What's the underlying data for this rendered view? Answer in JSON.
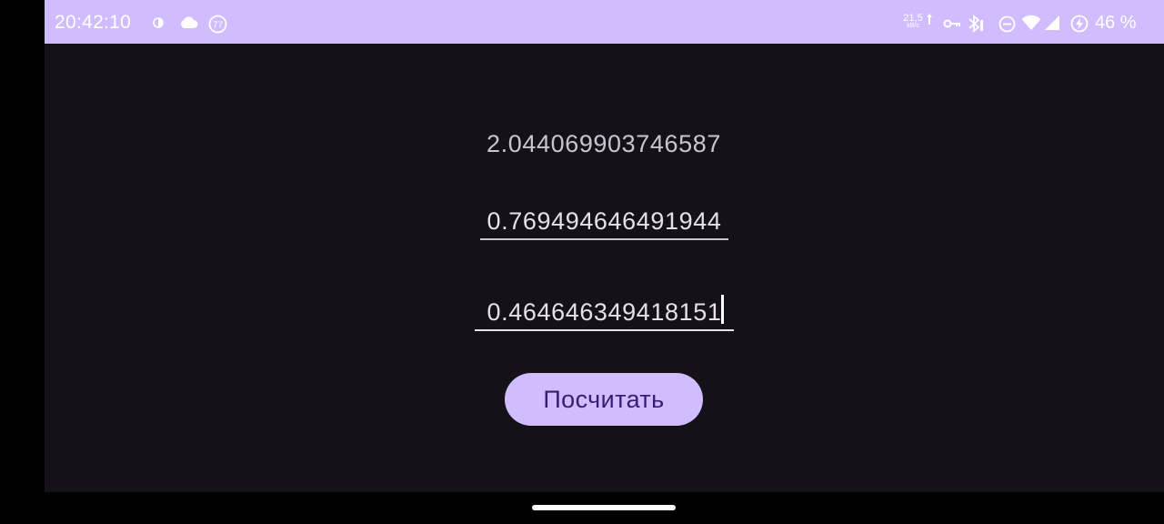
{
  "status_bar": {
    "time": "20:42:10",
    "icons": [
      "night-mode-icon",
      "cloud-icon",
      "notification-badge-icon",
      "network-speed-indicator",
      "vpn-key-icon",
      "bluetooth-icon",
      "do-not-disturb-icon",
      "wifi-icon",
      "signal-icon",
      "battery-saver-icon"
    ],
    "badge_number": "77",
    "net_speed_value": "21,5",
    "net_speed_unit": "kB/s",
    "battery_percent": "46 %"
  },
  "app": {
    "result_text": "2.044069903746587",
    "input_a_value": "0.769494646491944",
    "input_b_value": "0.464646349418151",
    "calculate_button_label": "Посчитать"
  },
  "colors": {
    "status_bar_bg": "#d0bcfe",
    "app_bg": "#141218",
    "button_bg": "#d0bcfe",
    "button_text": "#381e72",
    "text_secondary": "#cac4d0",
    "text_primary": "#e6e0e9"
  }
}
